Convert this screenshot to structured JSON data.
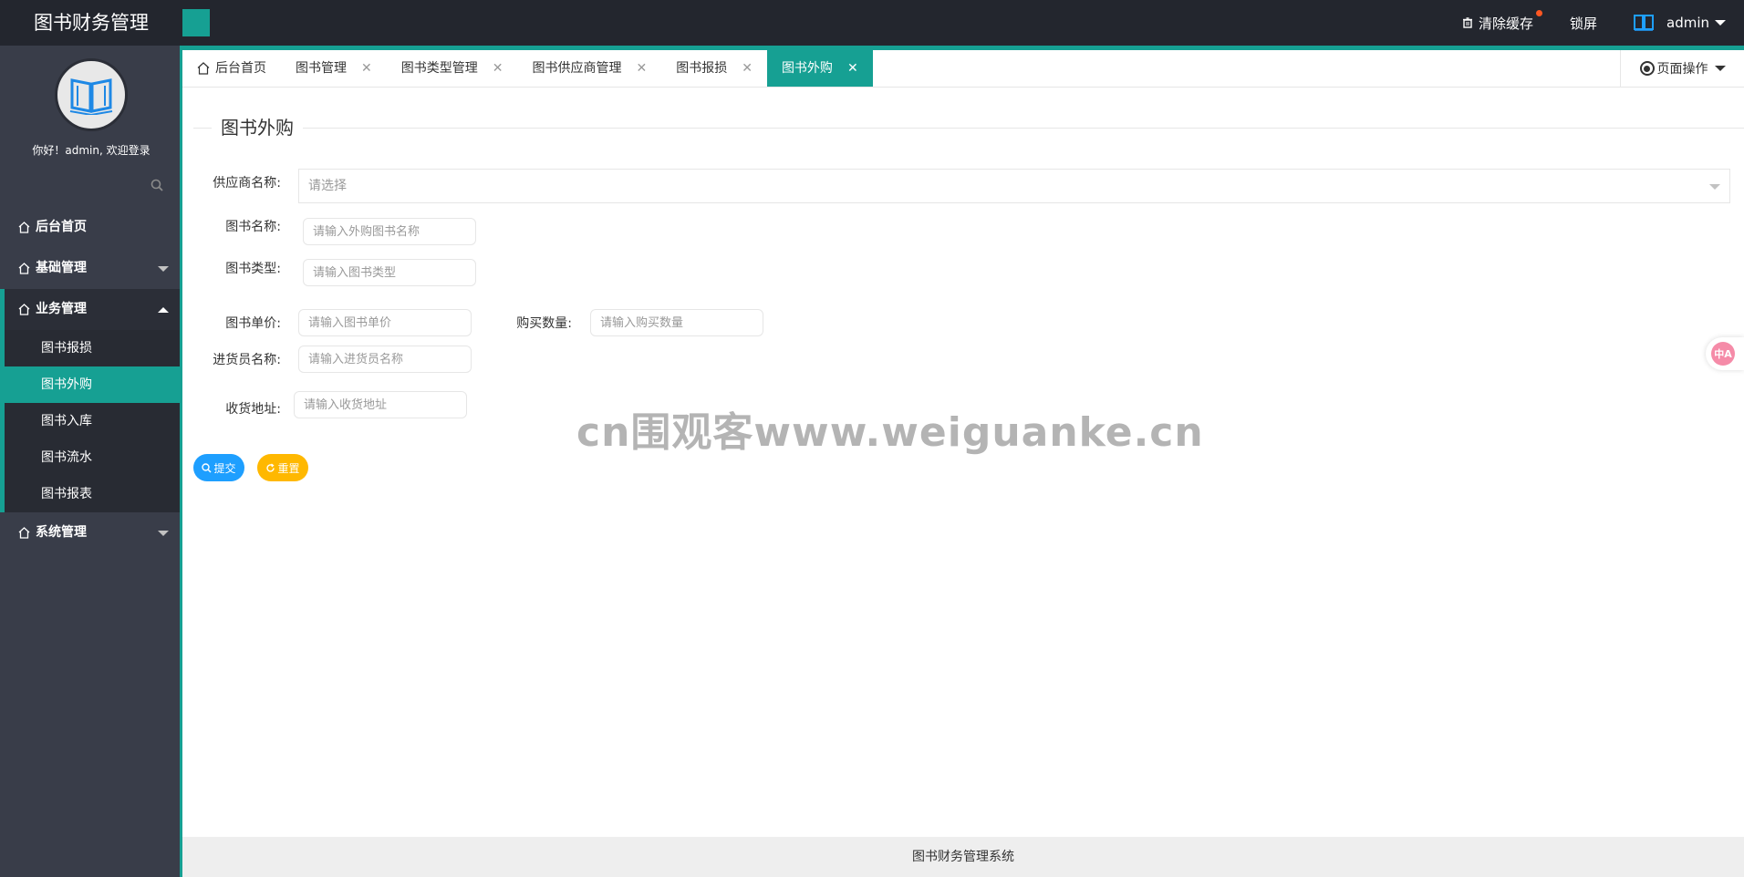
{
  "app": {
    "title": "图书财务管理"
  },
  "header": {
    "clear_cache": "清除缓存",
    "lock_screen": "锁屏",
    "username": "admin"
  },
  "sidebar": {
    "welcome": "你好！admin, 欢迎登录",
    "menu": [
      {
        "label": "后台首页"
      },
      {
        "label": "基础管理"
      },
      {
        "label": "业务管理"
      },
      {
        "label": "系统管理"
      }
    ],
    "submenu": [
      {
        "label": "图书报损"
      },
      {
        "label": "图书外购"
      },
      {
        "label": "图书入库"
      },
      {
        "label": "图书流水"
      },
      {
        "label": "图书报表"
      }
    ]
  },
  "tabs": [
    {
      "label": "后台首页"
    },
    {
      "label": "图书管理"
    },
    {
      "label": "图书类型管理"
    },
    {
      "label": "图书供应商管理"
    },
    {
      "label": "图书报损"
    },
    {
      "label": "图书外购"
    }
  ],
  "page_ops": "页面操作",
  "form": {
    "title": "图书外购",
    "supplier_label": "供应商名称:",
    "supplier_placeholder": "请选择",
    "book_name_label": "图书名称:",
    "book_name_placeholder": "请输入外购图书名称",
    "book_type_label": "图书类型:",
    "book_type_placeholder": "请输入图书类型",
    "unit_price_label": "图书单价:",
    "unit_price_placeholder": "请输入图书单价",
    "quantity_label": "购买数量:",
    "quantity_placeholder": "请输入购买数量",
    "buyer_label": "进货员名称:",
    "buyer_placeholder": "请输入进货员名称",
    "address_label": "收货地址:",
    "address_placeholder": "请输入收货地址",
    "submit": "提交",
    "reset": "重置"
  },
  "watermark": "cn围观客www.weiguanke.cn",
  "translate_label": "中A",
  "footer": "图书财务管理系统",
  "colors": {
    "accent": "#16a093",
    "header_bg": "#23262e",
    "sidebar_bg": "#393d49",
    "submit_btn": "#1e9fff",
    "reset_btn": "#ffb800"
  }
}
